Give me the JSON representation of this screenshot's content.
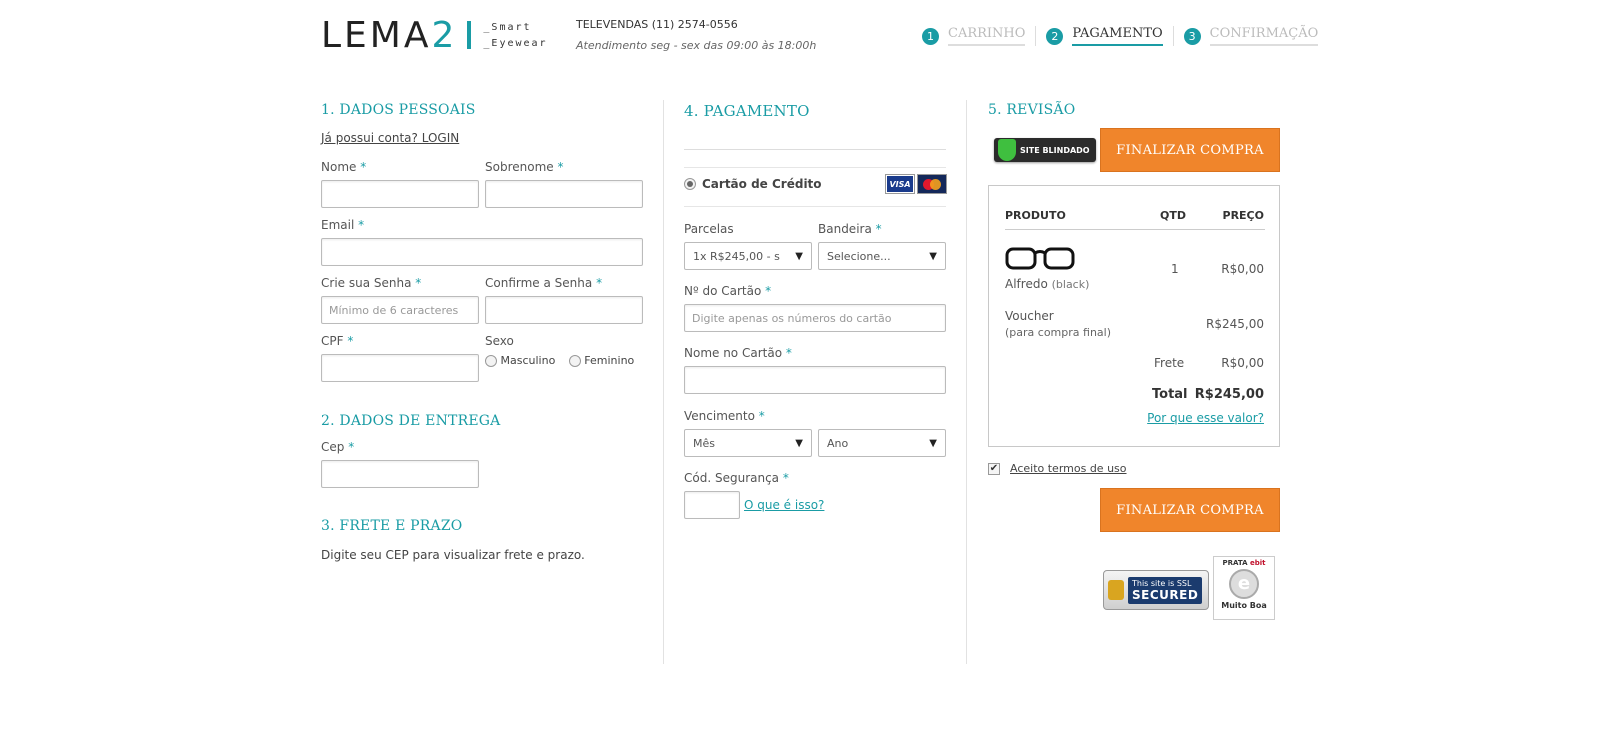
{
  "header": {
    "logo_main": "LEMA",
    "logo_num": "2",
    "logo_sub1": "_Smart",
    "logo_sub2": "_Eyewear",
    "phone": "TELEVENDAS (11) 2574-0556",
    "hours": "Atendimento seg - sex das 09:00 às 18:00h",
    "steps": [
      {
        "num": "1",
        "label": "CARRINHO"
      },
      {
        "num": "2",
        "label": "PAGAMENTO"
      },
      {
        "num": "3",
        "label": "CONFIRMAÇÃO"
      }
    ]
  },
  "personal": {
    "title": "1. DADOS PESSOAIS",
    "login_link": "Já possui conta? LOGIN",
    "nome_label": "Nome",
    "sobrenome_label": "Sobrenome",
    "email_label": "Email",
    "senha_label": "Crie sua Senha",
    "senha_placeholder": "Mínimo de 6 caracteres",
    "confirma_label": "Confirme a Senha",
    "cpf_label": "CPF",
    "sexo_label": "Sexo",
    "sexo_options": [
      "Masculino",
      "Feminino"
    ],
    "required_mark": "*"
  },
  "delivery": {
    "title": "2. DADOS DE ENTREGA",
    "cep_label": "Cep"
  },
  "shipping": {
    "title": "3. FRETE E PRAZO",
    "note": "Digite seu CEP para visualizar frete e prazo."
  },
  "payment": {
    "title": "4. PAGAMENTO",
    "method": "Cartão de Crédito",
    "card_brands": [
      "VISA",
      "MasterCard"
    ],
    "parcelas_label": "Parcelas",
    "parcelas_value": "1x R$245,00 - s",
    "bandeira_label": "Bandeira",
    "bandeira_value": "Selecione...",
    "card_number_label": "Nº do Cartão",
    "card_number_placeholder": "Digite apenas os números do cartão",
    "card_name_label": "Nome no Cartão",
    "vencimento_label": "Vencimento",
    "mes_value": "Mês",
    "ano_value": "Ano",
    "cvv_label": "Cód. Segurança",
    "cvv_help": "O que é isso?"
  },
  "review": {
    "title": "5. REVISÃO",
    "blindado_badge": "SITE BLINDADO",
    "finalize_label": "FINALIZAR COMPRA",
    "headers": {
      "product": "PRODUTO",
      "qty": "QTD",
      "price": "PREÇO"
    },
    "item": {
      "name": "Alfredo",
      "variant": "(black)",
      "qty": "1",
      "price": "R$0,00"
    },
    "voucher": {
      "name": "Voucher",
      "note": "(para compra final)",
      "price": "R$245,00"
    },
    "frete_label": "Frete",
    "frete_value": "R$0,00",
    "total_label": "Total",
    "total_value": "R$245,00",
    "why_link": "Por que esse valor?",
    "terms_label": "Aceito termos de uso",
    "ssl_line1": "This site is SSL",
    "ssl_line2": "SECURED",
    "ebit_top": "PRATA",
    "ebit_brand": "ebit",
    "ebit_bottom": "Muito Boa"
  },
  "colors": {
    "accent": "#1a9ca5",
    "button": "#f0852b"
  }
}
